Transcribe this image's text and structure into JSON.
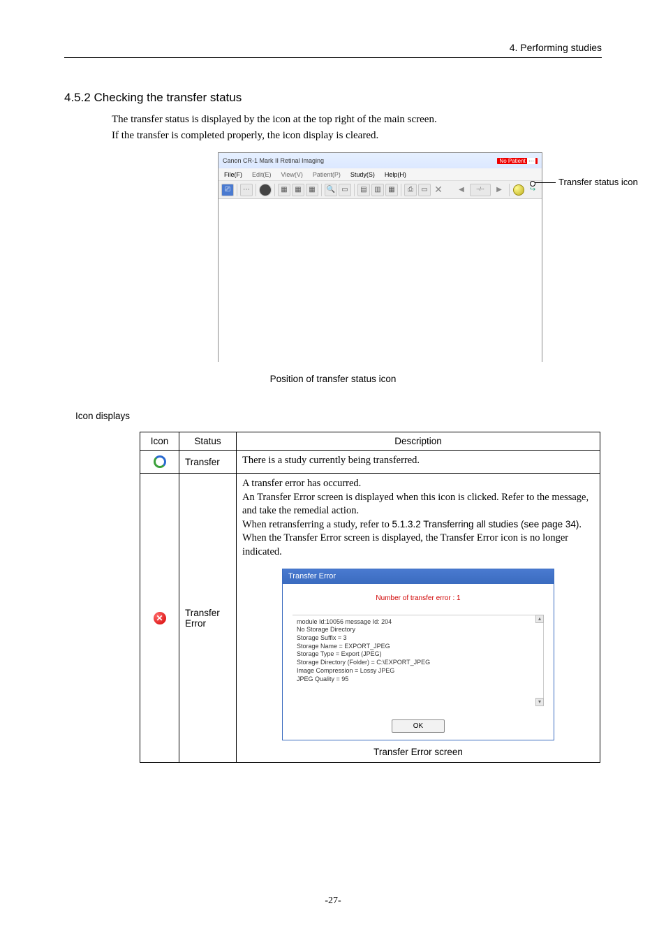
{
  "header": {
    "right": "4. Performing studies"
  },
  "section_title": "4.5.2 Checking the transfer status",
  "body": {
    "line1": "The transfer status is displayed by the icon at the top right of the main screen.",
    "line2": "If the transfer is completed properly, the icon display is cleared."
  },
  "figure1": {
    "window_title": "Canon CR-1 Mark II  Retinal Imaging",
    "patient_badge": "No Patient",
    "menus": {
      "file": "File(F)",
      "edit": "Edit(E)",
      "view": "View(V)",
      "patient": "Patient(P)",
      "study": "Study(S)",
      "help": "Help(H)"
    },
    "caption": "Position of transfer status icon",
    "status_label": "Transfer status icon"
  },
  "icon_displays_label": "Icon displays",
  "table": {
    "headers": {
      "icon": "Icon",
      "status": "Status",
      "description": "Description"
    },
    "row_transfer": {
      "status": "Transfer",
      "description": "There is a study currently being transferred."
    },
    "row_error": {
      "status": "Transfer Error",
      "desc_p1": "A transfer error has occurred.",
      "desc_p2": "An Transfer Error screen is displayed when this icon is clicked. Refer to the message, and take the remedial action.",
      "desc_p3a": "When retransferring a study, refer to ",
      "desc_p3b": "5.1.3.2 Transferring all studies (see page 34)",
      "desc_p3c": ".",
      "desc_p4": "When the Transfer Error screen is displayed, the Transfer Error icon is no longer indicated.",
      "dialog": {
        "title": "Transfer Error",
        "count": "Number of transfer error : 1",
        "details_lines": [
          "module Id:10056 message Id: 204",
          "No Storage Directory",
          "Storage Suffix = 3",
          "Storage Name = EXPORT_JPEG",
          "Storage Type = Export (JPEG)",
          "Storage Directory (Folder) = C:\\EXPORT_JPEG",
          "Image Compression = Lossy JPEG",
          "JPEG Quality = 95"
        ],
        "ok": "OK"
      },
      "dialog_caption": "Transfer Error screen"
    }
  },
  "page_number": "-27-"
}
